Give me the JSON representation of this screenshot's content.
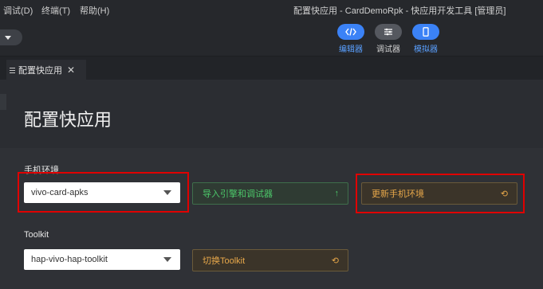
{
  "menu": {
    "items": [
      {
        "label": "调试(D)"
      },
      {
        "label": "终端(T)"
      },
      {
        "label": "帮助(H)"
      }
    ],
    "window_title": "配置快应用 - CardDemoRpk - 快应用开发工具 [管理员]"
  },
  "toolbar": {
    "modes": [
      {
        "label": "编辑器",
        "icon": "code-icon"
      },
      {
        "label": "调试器",
        "icon": "sliders-icon"
      },
      {
        "label": "模拟器",
        "icon": "phone-icon"
      }
    ]
  },
  "tabs": [
    {
      "label": "配置快应用",
      "icon": "list-icon",
      "close": "✕"
    }
  ],
  "page": {
    "title": "配置快应用",
    "phone_env": {
      "label": "手机环境",
      "selected": "vivo-card-apks",
      "import_button": "导入引擎和调试器",
      "import_glyph": "↑",
      "update_button": "更新手机环境",
      "update_glyph": "⟲"
    },
    "toolkit": {
      "label": "Toolkit",
      "selected": "hap-vivo-hap-toolkit",
      "switch_button": "切换Toolkit",
      "switch_glyph": "⟲"
    }
  },
  "colors": {
    "accent_blue": "#3b82f6",
    "green_text": "#4cc86a",
    "orange_text": "#e8a84a",
    "highlight_red": "#e00000"
  }
}
